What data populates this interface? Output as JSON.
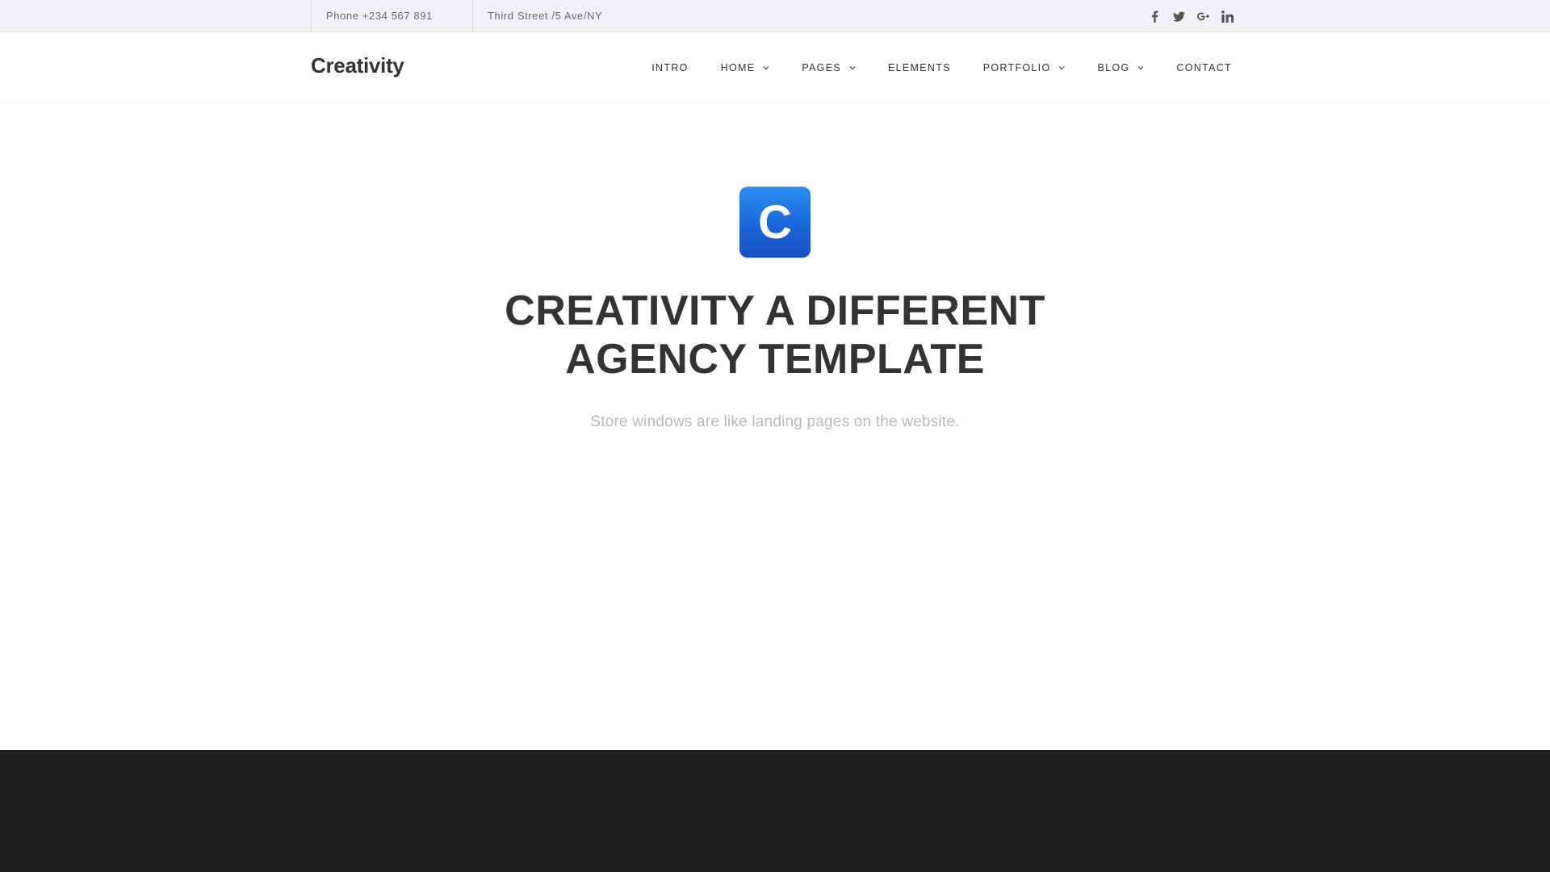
{
  "topbar": {
    "phone": "Phone +234 567 891",
    "address": "Third Street /5 Ave/NY",
    "social": [
      {
        "icon": "facebook-icon"
      },
      {
        "icon": "twitter-icon"
      },
      {
        "icon": "google-plus-icon"
      },
      {
        "icon": "linkedin-icon"
      }
    ]
  },
  "header": {
    "logo": "Creativity",
    "nav": [
      {
        "label": "INTRO",
        "dropdown": false
      },
      {
        "label": "HOME",
        "dropdown": true
      },
      {
        "label": "PAGES",
        "dropdown": true
      },
      {
        "label": "ELEMENTS",
        "dropdown": false
      },
      {
        "label": "PORTFOLIO",
        "dropdown": true
      },
      {
        "label": "BLOG",
        "dropdown": true
      },
      {
        "label": "CONTACT",
        "dropdown": false
      }
    ]
  },
  "hero": {
    "badge_letter": "C",
    "title_line1": "CREATIVITY A DIFFERENT",
    "title_line2": "AGENCY TEMPLATE",
    "subtitle": "Store windows are like landing pages on the website."
  },
  "colors": {
    "topbar_bg": "#f1f1f5",
    "badge_blue": "#1a66d8",
    "title": "#333333",
    "subtitle": "#b9b9bd",
    "dark_band": "#1e1e1e"
  }
}
